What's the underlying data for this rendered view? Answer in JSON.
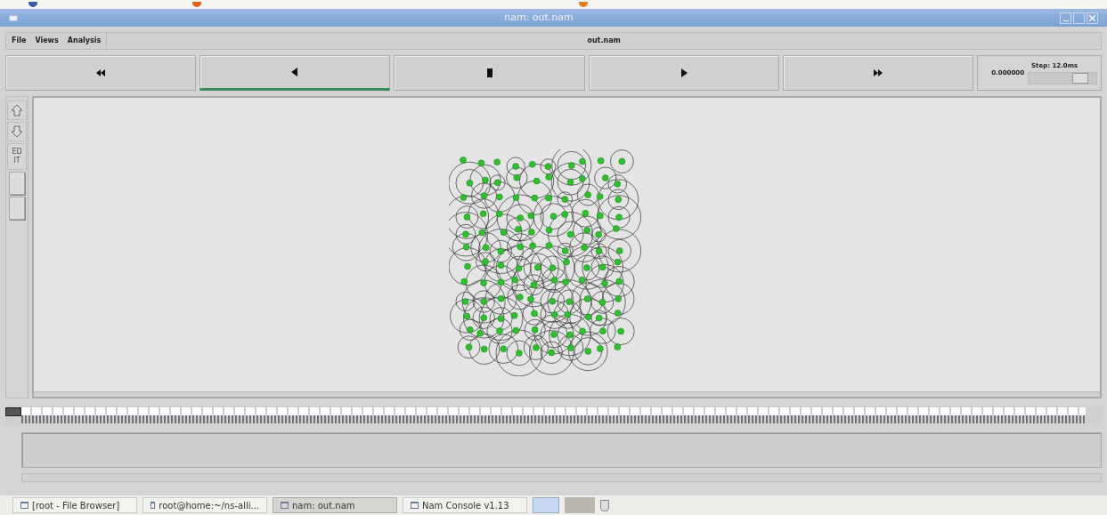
{
  "window": {
    "title": "nam: out.nam"
  },
  "menu": [
    {
      "label": "File"
    },
    {
      "label": "Views"
    },
    {
      "label": "Analysis"
    }
  ],
  "file_label": "out.nam",
  "transport": [
    {
      "kind": "rewind",
      "selected": false
    },
    {
      "kind": "back",
      "selected": true
    },
    {
      "kind": "stop",
      "selected": false
    },
    {
      "kind": "play",
      "selected": false
    },
    {
      "kind": "forward",
      "selected": false
    }
  ],
  "time": "0.000000",
  "step": {
    "label": "Step: 12.0ms",
    "level": 0.85
  },
  "side_tools": [
    {
      "kind": "zoom-in"
    },
    {
      "kind": "zoom-out"
    },
    {
      "kind": "edit",
      "label": "ED IT"
    },
    {
      "kind": "toggle"
    },
    {
      "kind": "toggle"
    }
  ],
  "timeline": {
    "level": 0
  },
  "taskbar": [
    {
      "label": "[root - File Browser]",
      "selected": false
    },
    {
      "label": "root@home:~/ns-alli...",
      "selected": false
    },
    {
      "label": "nam: out.nam",
      "selected": true
    },
    {
      "label": "Nam Console v1.13",
      "selected": false
    }
  ]
}
